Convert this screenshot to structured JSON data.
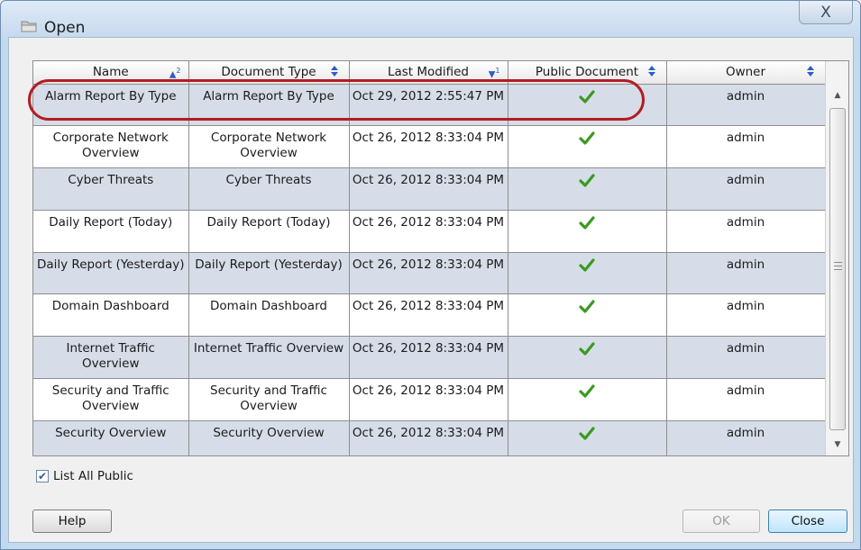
{
  "window": {
    "title": "Open",
    "close_glyph": "X"
  },
  "table": {
    "columns": [
      {
        "label": "Name",
        "sort": "ascending",
        "sort_rank": "2"
      },
      {
        "label": "Document Type",
        "sort": "none"
      },
      {
        "label": "Last Modified",
        "sort": "descending",
        "sort_rank": "1"
      },
      {
        "label": "Public Document",
        "sort": "none"
      },
      {
        "label": "Owner",
        "sort": "none"
      }
    ],
    "rows": [
      {
        "name": "Alarm Report By Type",
        "doc_type": "Alarm Report By Type",
        "modified": "Oct 29, 2012 2:55:47 PM",
        "public": true,
        "owner": "admin",
        "highlighted": true
      },
      {
        "name": "Corporate Network Overview",
        "doc_type": "Corporate Network Overview",
        "modified": "Oct 26, 2012 8:33:04 PM",
        "public": true,
        "owner": "admin"
      },
      {
        "name": "Cyber Threats",
        "doc_type": "Cyber Threats",
        "modified": "Oct 26, 2012 8:33:04 PM",
        "public": true,
        "owner": "admin"
      },
      {
        "name": "Daily Report (Today)",
        "doc_type": "Daily Report (Today)",
        "modified": "Oct 26, 2012 8:33:04 PM",
        "public": true,
        "owner": "admin"
      },
      {
        "name": "Daily Report (Yesterday)",
        "doc_type": "Daily Report (Yesterday)",
        "modified": "Oct 26, 2012 8:33:04 PM",
        "public": true,
        "owner": "admin"
      },
      {
        "name": "Domain Dashboard",
        "doc_type": "Domain Dashboard",
        "modified": "Oct 26, 2012 8:33:04 PM",
        "public": true,
        "owner": "admin"
      },
      {
        "name": "Internet Traffic Overview",
        "doc_type": "Internet Traffic Overview",
        "modified": "Oct 26, 2012 8:33:04 PM",
        "public": true,
        "owner": "admin"
      },
      {
        "name": "Security and Traffic Overview",
        "doc_type": "Security and Traffic Overview",
        "modified": "Oct 26, 2012 8:33:04 PM",
        "public": true,
        "owner": "admin"
      },
      {
        "name": "Security Overview",
        "doc_type": "Security Overview",
        "modified": "Oct 26, 2012 8:33:04 PM",
        "public": true,
        "owner": "admin"
      }
    ]
  },
  "options": {
    "list_all_public_label": "List All Public",
    "list_all_public_checked": true
  },
  "buttons": {
    "help": "Help",
    "ok": "OK",
    "close": "Close"
  },
  "colors": {
    "highlight_ring": "#b31c23",
    "check_green": "#3a9a1f",
    "sort_indicator": "#2a5ec8",
    "alt_row": "#d6dde8"
  },
  "icons": {
    "title": "open-folder-icon",
    "public": "checkmark-icon"
  }
}
